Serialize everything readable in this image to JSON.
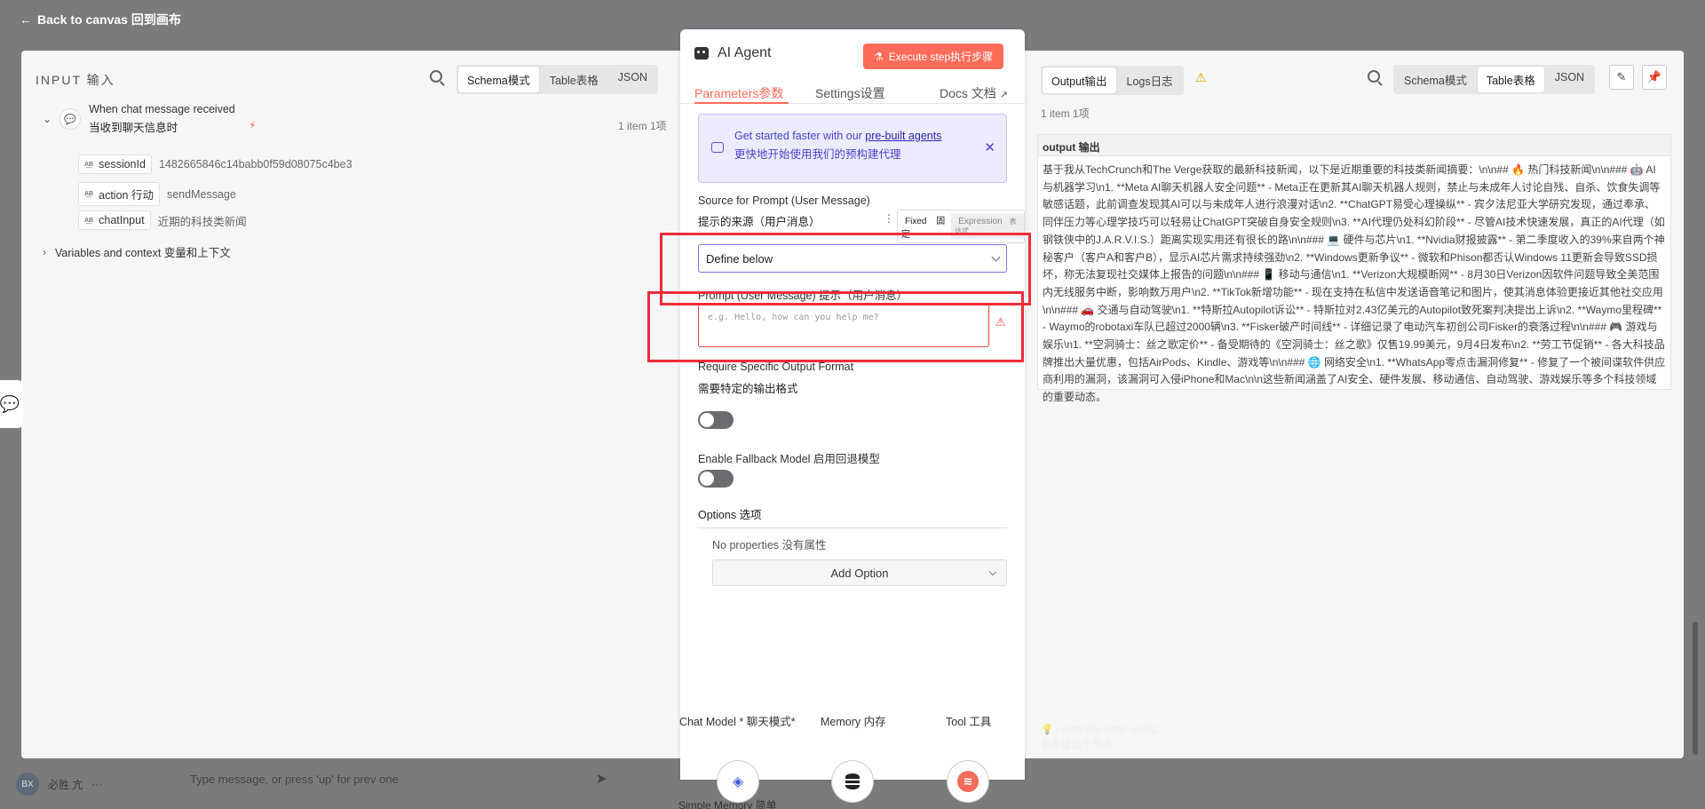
{
  "backdrop": {
    "back_label": "Back to canvas 回到画布",
    "user_name": "必胜 亢",
    "user_initials": "BX",
    "chat_placeholder": "Type message, or press 'up' for prev one",
    "memory_label": "Simple Memory 简单"
  },
  "input_pane": {
    "title": "INPUT 输入",
    "tabs": [
      "Schema模式",
      "Table表格",
      "JSON"
    ],
    "active_tab": "Schema模式",
    "trigger": {
      "line1": "When chat message received",
      "line2": "当收到聊天信息时",
      "items": "1 item 1项"
    },
    "fields": [
      {
        "name": "sessionId",
        "value": "1482665846c14babb0f59d08075c4be3"
      },
      {
        "name": "action 行动",
        "value": "sendMessage"
      },
      {
        "name": "chatInput",
        "value": "近期的科技类新闻"
      }
    ],
    "vars_label": "Variables and context 变量和上下文"
  },
  "node": {
    "title": "AI Agent",
    "execute_label": "Execute step执行步骤",
    "tabs": {
      "parameters": "Parameters参数",
      "settings": "Settings设置",
      "docs": "Docs 文档"
    },
    "banner": {
      "prefix": "Get started faster with our ",
      "link": "pre-built agents",
      "line2": "更快地开始使用我们的预构建代理"
    },
    "source_label": "Source for Prompt (User Message)",
    "source_label_cn": "提示的来源（用户消息）",
    "fixed_label": "Fixed",
    "fixed_cn": "固定",
    "expression_label": "Expression",
    "expression_cn": "表达式",
    "select_value": "Define below",
    "prompt_label": "Prompt (User Message) 提示（用户消息）",
    "prompt_placeholder": "e.g. Hello, how can you help me?",
    "output_format_label": "Require Specific Output Format",
    "output_format_cn": "需要特定的输出格式",
    "fallback_label": "Enable Fallback Model 启用回退模型",
    "options_label": "Options 选项",
    "no_props": "No properties 没有属性",
    "add_option": "Add Option",
    "sub_nodes": {
      "chat_model": "Chat Model * 聊天模式*",
      "memory": "Memory 内存",
      "tool": "Tool 工具"
    }
  },
  "output_pane": {
    "tabs": [
      "Output输出",
      "Logs日志"
    ],
    "active_tab": "Output输出",
    "view_tabs": [
      "Schema模式",
      "Table表格",
      "JSON"
    ],
    "active_view": "Table表格",
    "items": "1 item 1项",
    "column": "output 输出",
    "text": "基于我从TechCrunch和The Verge获取的最新科技新闻，以下是近期重要的科技类新闻摘要：\\n\\n## 🔥 热门科技新闻\\n\\n### 🤖 AI与机器学习\\n1. **Meta AI聊天机器人安全问题** - Meta正在更新其AI聊天机器人规则，禁止与未成年人讨论自残、自杀、饮食失调等敏感话题，此前调查发现其AI可以与未成年人进行浪漫对话\\n2. **ChatGPT易受心理操纵** - 宾夕法尼亚大学研究发现，通过奉承、同伴压力等心理学技巧可以轻易让ChatGPT突破自身安全规则\\n3. **AI代理仍处科幻阶段** - 尽管AI技术快速发展，真正的AI代理（如钢铁侠中的J.A.R.V.I.S.）距离实现实用还有很长的路\\n\\n### 💻 硬件与芯片\\n1. **Nvidia财报披露** - 第二季度收入的39%来自两个神秘客户（客户A和客户B），显示AI芯片需求持续强劲\\n2. **Windows更新争议** - 微软和Phison都否认Windows 11更新会导致SSD损坏，称无法复现社交媒体上报告的问题\\n\\n### 📱 移动与通信\\n1. **Verizon大规模断网** - 8月30日Verizon因软件问题导致全美范围内无线服务中断，影响数万用户\\n2. **TikTok新增功能** - 现在支持在私信中发送语音笔记和图片，使其消息体验更接近其他社交应用\\n\\n### 🚗 交通与自动驾驶\\n1. **特斯拉Autopilot诉讼** - 特斯拉对2.43亿美元的Autopilot致死案判决提出上诉\\n2. **Waymo里程碑** - Waymo的robotaxi车队已超过2000辆\\n3. **Fisker破产时间线** - 详细记录了电动汽车初创公司Fisker的衰落过程\\n\\n### 🎮 游戏与娱乐\\n1. **空洞骑士：丝之歌定价** - 备受期待的《空洞骑士：丝之歌》仅售19.99美元，9月4日发布\\n2. **劳工节促销** - 各大科技品牌推出大量优惠，包括AirPods、Kindle、游戏等\\n\\n### 🌐 网络安全\\n1. **WhatsApp零点击漏洞修复** - 修复了一个被间谍软件供应商利用的漏洞，该漏洞可入侵iPhone和Mac\\n\\n这些新闻涵盖了AI安全、硬件发展、移动通信、自动驾驶、游戏娱乐等多个科技领域的重要动态。",
    "wish_line1": "I wish this node would...",
    "wish_line2": "我希望这个节点..."
  }
}
